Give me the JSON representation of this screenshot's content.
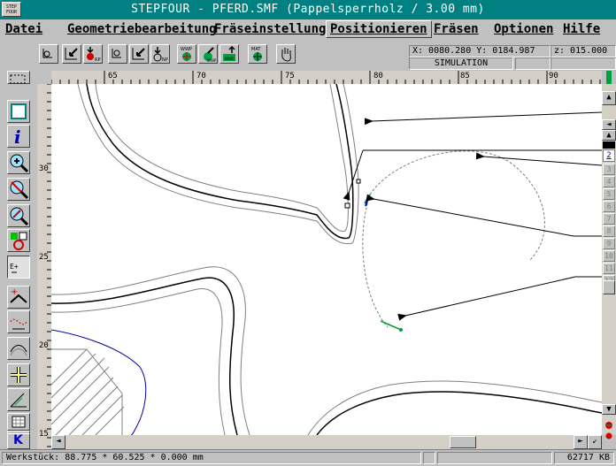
{
  "window": {
    "logo_text": "STEP FOUR",
    "title": "STEPFOUR - PFERD.SMF (Pappelsperrholz / 3.00 mm)"
  },
  "menu": [
    {
      "label": "Datei"
    },
    {
      "label": "Geometriebearbeitung"
    },
    {
      "label": "Fräseinstellungen"
    },
    {
      "label": "Positionieren"
    },
    {
      "label": "Fräsen"
    },
    {
      "label": "Optionen"
    },
    {
      "label": "Hilfe"
    }
  ],
  "toolbar": {
    "coords_line": "X: 0080.280 Y: 0184.987",
    "z_coord": "z: 015.000",
    "mode": "SIMULATION",
    "btn_rp": "RP",
    "btn_np": "NP",
    "btn_wwp": "WWP",
    "btn_wwp2": "WWP",
    "btn_wwc": "WWC",
    "btn_mat": "MAT"
  },
  "ruler": {
    "h_labels": [
      "65",
      "70",
      "75",
      "80",
      "85",
      "90"
    ],
    "v_labels": [
      "30",
      "25",
      "20",
      "15"
    ]
  },
  "right_palette": {
    "items": [
      "1",
      "2",
      "3",
      "4",
      "5",
      "6",
      "7",
      "8",
      "9",
      "10",
      "11",
      "12"
    ]
  },
  "statusbar": {
    "workpiece": "Werkstück: 88.775 * 60.525 * 0.000 mm",
    "memory": "62717 KB"
  },
  "lefttools": {
    "k_label": "K",
    "ep_label": "E+"
  },
  "colors": {
    "title_bg": "#008080",
    "outline_gray": "#808080",
    "green_path": "#00a040",
    "blue_line": "#0000a0"
  }
}
